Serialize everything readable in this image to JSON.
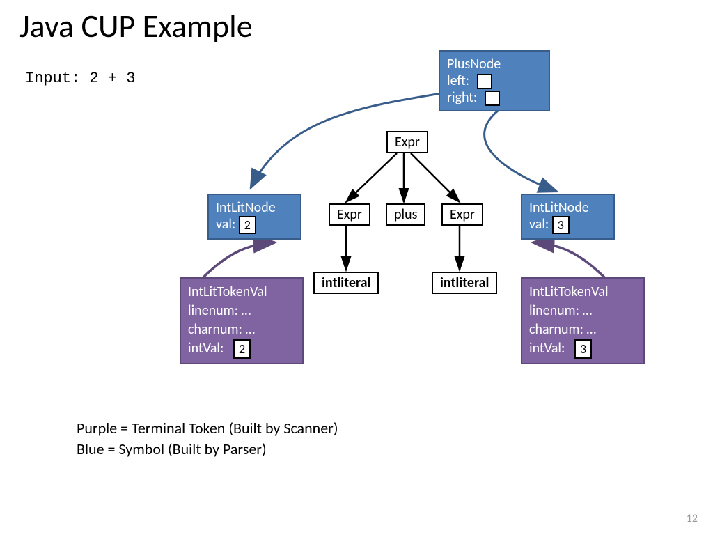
{
  "title": "Java CUP Example",
  "input_line": "Input: 2 +    3",
  "plus_node": {
    "name": "PlusNode",
    "left_label": "left:",
    "right_label": "right:"
  },
  "tree": {
    "expr_root": "Expr",
    "expr_left": "Expr",
    "plus": "plus",
    "expr_right": "Expr",
    "intliteral_left": "intliteral",
    "intliteral_right": "intliteral"
  },
  "intlit_left": {
    "name": "IntLitNode",
    "val_label": "val:",
    "val": "2"
  },
  "intlit_right": {
    "name": "IntLitNode",
    "val_label": "val:",
    "val": "3"
  },
  "token_left": {
    "name": "IntLitTokenVal",
    "linenum": "linenum:  …",
    "charnum": "charnum: …",
    "intval_label": "intVal:",
    "intval": "2"
  },
  "token_right": {
    "name": "IntLitTokenVal",
    "linenum": "linenum:  …",
    "charnum": "charnum: …",
    "intval_label": "intVal:",
    "intval": "3"
  },
  "legend": {
    "purple": "Purple = Terminal Token (Built by Scanner)",
    "blue": "Blue = Symbol (Built by Parser)"
  },
  "page_number": "12",
  "colors": {
    "blue": "#4f81bd",
    "blue_border": "#385d8a",
    "purple": "#8064a2",
    "purple_border": "#5c497a"
  }
}
